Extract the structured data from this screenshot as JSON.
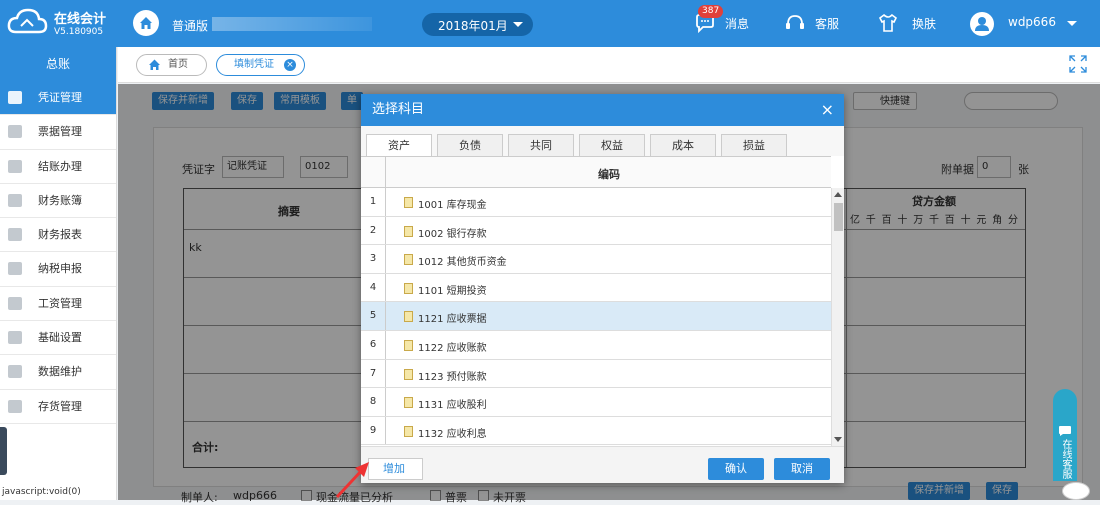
{
  "app": {
    "title": "在线会计",
    "version": "V5.180905"
  },
  "header": {
    "edition": "普通版",
    "period": "2018年01月",
    "message_label": "消息",
    "message_count": "387",
    "service_label": "客服",
    "skin_label": "换肤",
    "username": "wdp666"
  },
  "sidebar": {
    "section": "总账",
    "items": [
      {
        "label": "凭证管理",
        "icon": "voucher-icon",
        "active": true
      },
      {
        "label": "票据管理",
        "icon": "bill-icon"
      },
      {
        "label": "结账办理",
        "icon": "pen-icon"
      },
      {
        "label": "财务账簿",
        "icon": "ledger-icon"
      },
      {
        "label": "财务报表",
        "icon": "bar-chart-icon"
      },
      {
        "label": "纳税申报",
        "icon": "tax-icon"
      },
      {
        "label": "工资管理",
        "icon": "salary-icon"
      },
      {
        "label": "基础设置",
        "icon": "settings-icon"
      },
      {
        "label": "数据维护",
        "icon": "data-icon"
      },
      {
        "label": "存货管理",
        "icon": "inventory-icon"
      }
    ],
    "status": "javascript:void(0)"
  },
  "tabs": {
    "home": "首页",
    "current": "填制凭证"
  },
  "toolbar": {
    "save_new": "保存并新增",
    "save": "保存",
    "template": "常用模板",
    "more": "单",
    "shortcut": "快捷键"
  },
  "voucher": {
    "word_label": "凭证字",
    "word_value": "记账凭证",
    "number": "0102",
    "attach_label": "附单据",
    "attach_value": "0",
    "attach_unit": "张",
    "summary_header": "摘要",
    "credit_header": "贷方金额",
    "digits": [
      "亿",
      "千",
      "百",
      "十",
      "万",
      "千",
      "百",
      "十",
      "元",
      "角",
      "分"
    ],
    "first_summary": "kk",
    "total_label": "合计:",
    "maker_label": "制单人:",
    "maker_value": "wdp666",
    "cashflow_label": "现金流量已分析",
    "invoice_label": "普票",
    "noinvoice_label": "未开票",
    "bottom_save_new": "保存并新增",
    "bottom_save": "保存"
  },
  "modal": {
    "title": "选择科目",
    "tabs": [
      "资产",
      "负债",
      "共同",
      "权益",
      "成本",
      "损益"
    ],
    "active_tab": 0,
    "column_header": "编码",
    "rows": [
      {
        "index": "1",
        "text": "1001 库存现金"
      },
      {
        "index": "2",
        "text": "1002 银行存款"
      },
      {
        "index": "3",
        "text": "1012 其他货币资金"
      },
      {
        "index": "4",
        "text": "1101 短期投资"
      },
      {
        "index": "5",
        "text": "1121 应收票据",
        "selected": true
      },
      {
        "index": "6",
        "text": "1122 应收账款"
      },
      {
        "index": "7",
        "text": "1123 预付账款"
      },
      {
        "index": "8",
        "text": "1131 应收股利"
      },
      {
        "index": "9",
        "text": "1132 应收利息"
      }
    ],
    "add_label": "增加",
    "ok_label": "确认",
    "cancel_label": "取消"
  },
  "float": {
    "chat_label": "在线客服"
  }
}
